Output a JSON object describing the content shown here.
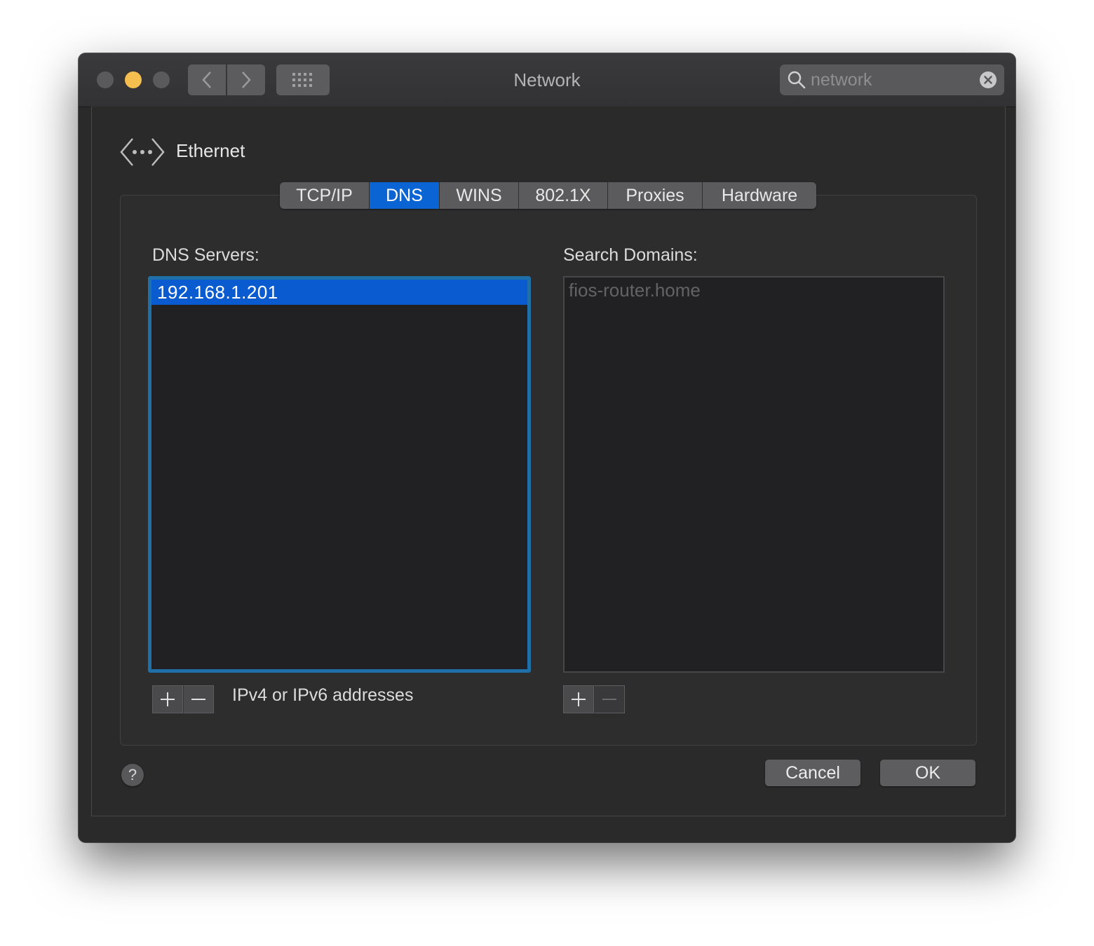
{
  "window": {
    "title": "Network"
  },
  "search": {
    "value": "network",
    "icon": "search-icon"
  },
  "header": {
    "service_name": "Ethernet",
    "icon": "ethernet-icon"
  },
  "tabs": [
    {
      "label": "TCP/IP",
      "active": false
    },
    {
      "label": "DNS",
      "active": true
    },
    {
      "label": "WINS",
      "active": false
    },
    {
      "label": "802.1X",
      "active": false
    },
    {
      "label": "Proxies",
      "active": false
    },
    {
      "label": "Hardware",
      "active": false
    }
  ],
  "dns_servers": {
    "label": "DNS Servers:",
    "items": [
      "192.168.1.201"
    ],
    "hint": "IPv4 or IPv6 addresses"
  },
  "search_domains": {
    "label": "Search Domains:",
    "items": [
      "fios-router.home"
    ]
  },
  "buttons": {
    "help": "?",
    "cancel": "Cancel",
    "ok": "OK"
  },
  "colors": {
    "accent": "#0b64d4",
    "focus_ring": "#1f6fa8",
    "minimize": "#f4bf4f"
  }
}
